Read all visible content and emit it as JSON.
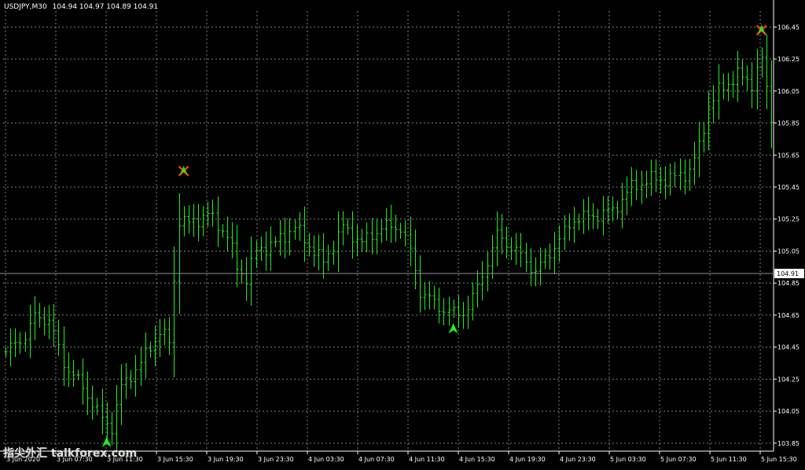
{
  "header": {
    "symbol": "USDJPY,M30",
    "ohlc": "104.94 104.97 104.89 104.91"
  },
  "watermark": "指尖外汇 talkforex.com",
  "colors": {
    "background": "#000000",
    "grid": "#7f7f7f",
    "bars": "#22ee22",
    "axis": "#ffffff",
    "bid_line": "#8f8f8f",
    "up_arrow": "#22ee22",
    "down_marker": "#ff3300"
  },
  "chart_data": {
    "type": "bar",
    "style": "ohlc",
    "symbol": "USDJPY",
    "timeframe": "M30",
    "ylim": [
      103.8,
      106.55
    ],
    "y_ticks": [
      "106.45",
      "106.25",
      "106.05",
      "105.85",
      "105.65",
      "105.45",
      "105.25",
      "105.05",
      "104.85",
      "104.65",
      "104.45",
      "104.25",
      "104.05",
      "103.85"
    ],
    "x_ticks": [
      "3 Jun 2020",
      "3 Jun 07:30",
      "3 Jun 11:30",
      "3 Jun 15:30",
      "3 Jun 19:30",
      "3 Jun 23:30",
      "4 Jun 03:30",
      "4 Jun 07:30",
      "4 Jun 11:30",
      "4 Jun 15:30",
      "4 Jun 19:30",
      "4 Jun 23:30",
      "5 Jun 03:30",
      "5 Jun 07:30",
      "5 Jun 11:30",
      "5 Jun 15:30"
    ],
    "current_price": "104.91",
    "grid": true,
    "anchors": [
      [
        0,
        104.42
      ],
      [
        4,
        104.52
      ],
      [
        6,
        104.64
      ],
      [
        9,
        104.62
      ],
      [
        12,
        104.35
      ],
      [
        16,
        104.2
      ],
      [
        20,
        104.0
      ],
      [
        22,
        103.95
      ],
      [
        24,
        104.2
      ],
      [
        28,
        104.35
      ],
      [
        32,
        104.55
      ],
      [
        34,
        104.48
      ],
      [
        36,
        105.25
      ],
      [
        38,
        105.22
      ],
      [
        42,
        105.28
      ],
      [
        46,
        105.15
      ],
      [
        48,
        104.95
      ],
      [
        50,
        104.88
      ],
      [
        52,
        105.05
      ],
      [
        56,
        105.1
      ],
      [
        60,
        105.2
      ],
      [
        64,
        105.05
      ],
      [
        66,
        104.98
      ],
      [
        70,
        105.2
      ],
      [
        74,
        105.1
      ],
      [
        78,
        105.2
      ],
      [
        82,
        105.2
      ],
      [
        84,
        105.05
      ],
      [
        86,
        104.8
      ],
      [
        90,
        104.7
      ],
      [
        94,
        104.65
      ],
      [
        96,
        104.7
      ],
      [
        98,
        104.82
      ],
      [
        102,
        105.15
      ],
      [
        106,
        105.05
      ],
      [
        110,
        104.92
      ],
      [
        114,
        105.08
      ],
      [
        118,
        105.25
      ],
      [
        122,
        105.27
      ],
      [
        126,
        105.3
      ],
      [
        130,
        105.45
      ],
      [
        134,
        105.5
      ],
      [
        138,
        105.5
      ],
      [
        142,
        105.55
      ],
      [
        144,
        105.7
      ],
      [
        146,
        105.95
      ],
      [
        148,
        106.05
      ],
      [
        152,
        106.15
      ],
      [
        155,
        106.1
      ],
      [
        157,
        106.25
      ],
      [
        158,
        106.05
      ],
      [
        159,
        105.9
      ]
    ],
    "signals": [
      {
        "type": "buy",
        "bar": 21,
        "price": 103.85
      },
      {
        "type": "sell",
        "bar": 37,
        "price": 105.55
      },
      {
        "type": "buy",
        "bar": 93,
        "price": 104.56
      },
      {
        "type": "sell",
        "bar": 157,
        "price": 106.43
      }
    ]
  }
}
